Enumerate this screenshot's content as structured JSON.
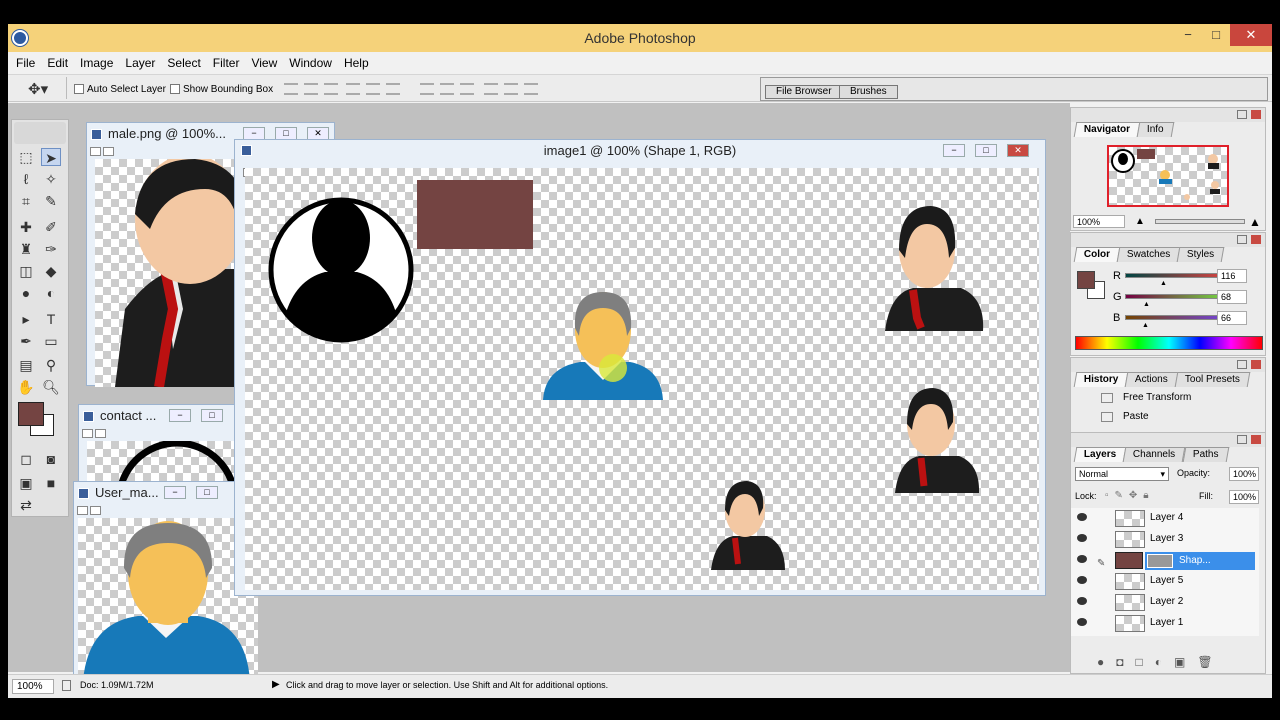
{
  "app": {
    "title": "Adobe Photoshop"
  },
  "window_buttons": {
    "minimize": "−",
    "maximize": "□",
    "close": "✕"
  },
  "menu": [
    "File",
    "Edit",
    "Image",
    "Layer",
    "Select",
    "Filter",
    "View",
    "Window",
    "Help"
  ],
  "options_bar": {
    "auto_select_layer": "Auto Select Layer",
    "show_bounding_box": "Show Bounding Box",
    "file_browser_tab": "File Browser",
    "brushes_tab": "Brushes"
  },
  "documents": {
    "male": {
      "title": "male.png @ 100%..."
    },
    "contact": {
      "title": "contact ..."
    },
    "user": {
      "title": "User_ma..."
    },
    "image1": {
      "title": "image1 @ 100% (Shape 1, RGB)"
    }
  },
  "navigator": {
    "tabs": [
      "Navigator",
      "Info"
    ],
    "zoom": "100%"
  },
  "color_panel": {
    "tabs": [
      "Color",
      "Swatches",
      "Styles"
    ],
    "r_label": "R",
    "g_label": "G",
    "b_label": "B",
    "r": "116",
    "g": "68",
    "b": "66",
    "fg_color": "#744442"
  },
  "history_panel": {
    "tabs": [
      "History",
      "Actions",
      "Tool Presets"
    ],
    "items": [
      "Free Transform",
      "Paste"
    ]
  },
  "layers_panel": {
    "tabs": [
      "Layers",
      "Channels",
      "Paths"
    ],
    "blend_mode": "Normal",
    "opacity_label": "Opacity:",
    "opacity": "100%",
    "lock_label": "Lock:",
    "fill_label": "Fill:",
    "fill": "100%",
    "layers": [
      "Layer 4",
      "Layer 3",
      "Shap...",
      "Layer 5",
      "Layer 2",
      "Layer 1"
    ],
    "selected_layer": "Shap..."
  },
  "status": {
    "zoom": "100%",
    "doc": "Doc: 1.09M/1.72M",
    "hint": "Click and drag to move layer or selection. Use Shift and Alt for additional options."
  },
  "colors": {
    "accent": "#f5d27a",
    "selection": "#3b8fea",
    "close": "#c9463d"
  }
}
